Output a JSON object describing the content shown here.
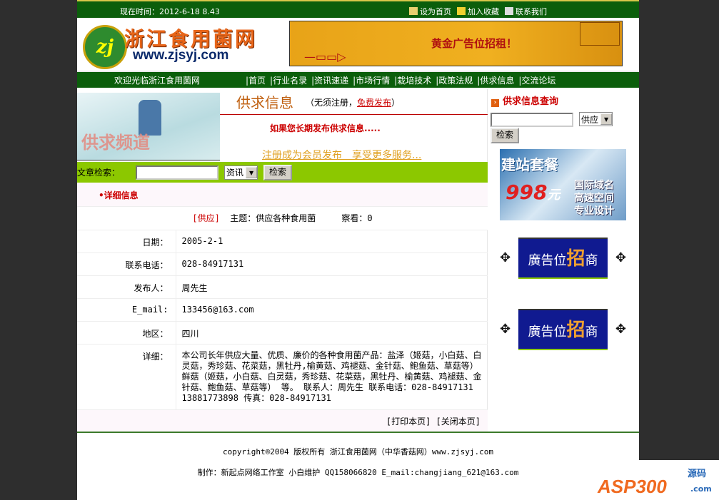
{
  "topbar": {
    "time": "现在时间：2012-6-18 8.43",
    "links": [
      {
        "label": "设为首页",
        "icon": "home-icon"
      },
      {
        "label": "加入收藏",
        "icon": "favorite-icon"
      },
      {
        "label": "联系我们",
        "icon": "mail-icon"
      }
    ]
  },
  "header": {
    "logo_mark": "zj",
    "site_name": "浙江食用菌网",
    "site_url": "www.zjsyj.com",
    "banner_text": "黄金广告位招租！"
  },
  "nav": {
    "welcome": "欢迎光临浙江食用菌网",
    "items": [
      "|首页",
      "|行业名录",
      "|资讯速递",
      "|市场行情",
      "|栽培技术",
      "|政策法规",
      "|供求信息",
      "|交流论坛"
    ]
  },
  "channel": {
    "image_text": "供求频道",
    "title": "供求信息",
    "sub_prefix": "（无须注册，",
    "sub_link": "免费发布",
    "sub_suffix": "）",
    "long_term": "如果您长期发布供求信息.....",
    "register": "注册成为会员发布　享受更多服务..."
  },
  "search": {
    "label": "文章检索：",
    "value": "",
    "select": "资讯",
    "button": "检索"
  },
  "detail": {
    "heading": "•详细信息",
    "type": "[供应]",
    "subject": "主题：供应各种食用菌",
    "views": "察看：0",
    "rows": [
      {
        "label": "日期：",
        "value": "2005-2-1"
      },
      {
        "label": "联系电话：",
        "value": "028-84917131"
      },
      {
        "label": "发布人：",
        "value": "周先生"
      },
      {
        "label": "E_mail:",
        "value": "133456@163.com"
      },
      {
        "label": "地区：",
        "value": "四川"
      },
      {
        "label": "详细：",
        "value": "本公司长年供应大量、优质、廉价的各种食用菌产品：盐泽（姬菇，小白菇、白灵菇，秀珍菇、花菜菇，黑牡丹,榆黄菇、鸡褪菇、金针菇、鲍鱼菇、草菇等） 鲜菇（姬菇，小白菇、白灵菇，秀珍菇、花菜菇，黑牡丹、榆黄菇、鸡褪菇、金针菇、鲍鱼菇、草菇等） 等。 联系人：周先生 联系电话：028-84917131 13881773898 传真：028-84917131"
      }
    ],
    "print": "[打印本页]",
    "close": "[关闭本页]"
  },
  "sidebar": {
    "query_title": "供求信息查询",
    "query_value": "",
    "query_select": "供应",
    "query_button": "检索",
    "ad_build": {
      "title": "建站套餐",
      "price": "998",
      "unit": "元",
      "lines": [
        "国际域名",
        "高速空间",
        "专业设计"
      ]
    },
    "ad_slots": [
      {
        "pre": "廣告位",
        "hl": "招",
        "post": "商"
      },
      {
        "pre": "廣告位",
        "hl": "招",
        "post": "商"
      }
    ]
  },
  "footer": {
    "copyright": "copyright®2004 版权所有 浙江食用菌网（中华香菇网）www.zjsyj.com",
    "credits": "制作：新起点网络工作室 小白维护 QQ158066820 E_mail:changjiang_621@163.com"
  },
  "watermark": {
    "text": "ASP300",
    "suffix": "源码",
    ".com": ".com"
  }
}
